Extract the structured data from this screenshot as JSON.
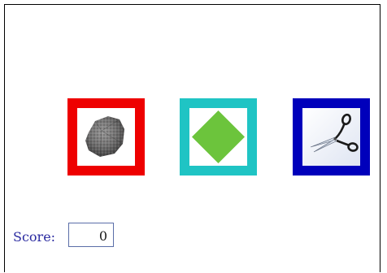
{
  "game": {
    "choices": [
      {
        "name": "rock",
        "icon": "rock-icon",
        "border_color": "#ee0000"
      },
      {
        "name": "paper",
        "icon": "paper-icon",
        "border_color": "#1fc4c4"
      },
      {
        "name": "scissors",
        "icon": "scissors-icon",
        "border_color": "#0000bb"
      }
    ]
  },
  "score": {
    "label": "Score:",
    "value": "0"
  }
}
